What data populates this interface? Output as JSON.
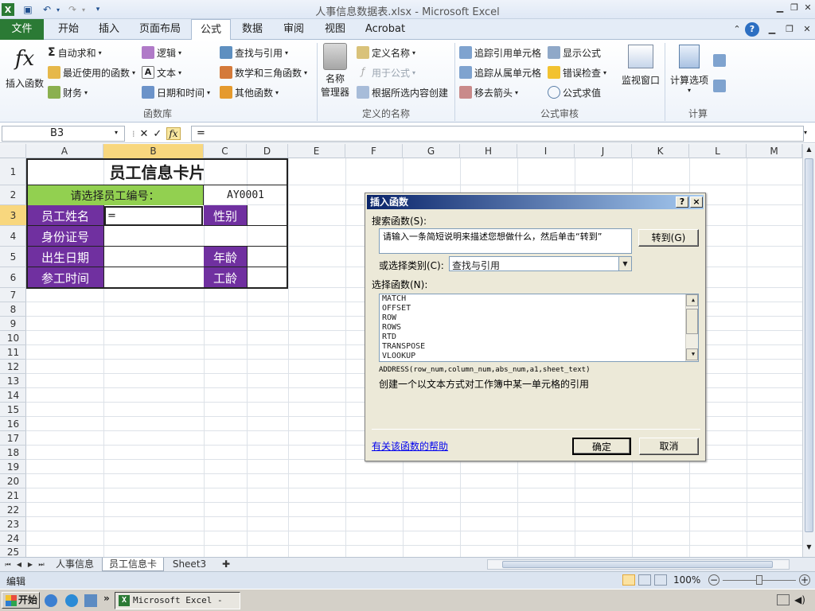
{
  "window": {
    "title": "人事信息数据表.xlsx - Microsoft Excel"
  },
  "tabs": {
    "file": "文件",
    "items": [
      "开始",
      "插入",
      "页面布局",
      "公式",
      "数据",
      "审阅",
      "视图",
      "Acrobat"
    ],
    "active": "公式"
  },
  "ribbon": {
    "insert_function": "插入函数",
    "autosum": "自动求和",
    "recent": "最近使用的函数",
    "finance": "财务",
    "logic": "逻辑",
    "text": "文本",
    "datetime": "日期和时间",
    "lookup": "查找与引用",
    "math": "数学和三角函数",
    "other": "其他函数",
    "group_library": "函数库",
    "name_manager_1": "名称",
    "name_manager_2": "管理器",
    "define_name": "定义名称",
    "use_in_formula": "用于公式",
    "create_from_sel": "根据所选内容创建",
    "group_names": "定义的名称",
    "trace_prec": "追踪引用单元格",
    "trace_dep": "追踪从属单元格",
    "remove_arrows": "移去箭头",
    "show_formulas": "显示公式",
    "error_check": "错误检查",
    "eval_formula": "公式求值",
    "group_audit": "公式审核",
    "watch": "监视窗口",
    "calc_options": "计算选项",
    "group_calc": "计算"
  },
  "formula_bar": {
    "name_box": "B3",
    "formula": "="
  },
  "columns": [
    "A",
    "B",
    "C",
    "D",
    "E",
    "F",
    "G",
    "H",
    "I",
    "J",
    "K",
    "L",
    "M"
  ],
  "rows": [
    "1",
    "2",
    "3",
    "4",
    "5",
    "6",
    "7",
    "8",
    "9",
    "10",
    "11",
    "12",
    "13",
    "14",
    "15",
    "16",
    "17",
    "18",
    "19",
    "20",
    "21",
    "22",
    "23",
    "24",
    "25"
  ],
  "card": {
    "title": "员工信息卡片",
    "select_label": "请选择员工编号：",
    "select_value": "AY0001",
    "name": "员工姓名",
    "b3_value": "=",
    "gender": "性别",
    "id": "身份证号",
    "birth": "出生日期",
    "age": "年龄",
    "join": "参工时间",
    "seniority": "工龄"
  },
  "dialog": {
    "title": "插入函数",
    "help_btn": "?",
    "close_btn": "×",
    "search_label": "搜索函数(S):",
    "search_text": "请输入一条简短说明来描述您想做什么，然后单击“转到”",
    "go_btn": "转到(G)",
    "category_label": "或选择类别(C):",
    "category_value": "查找与引用",
    "select_label": "选择函数(N):",
    "functions": [
      "MATCH",
      "OFFSET",
      "ROW",
      "ROWS",
      "RTD",
      "TRANSPOSE",
      "VLOOKUP"
    ],
    "syntax": "ADDRESS(row_num,column_num,abs_num,a1,sheet_text)",
    "description": "创建一个以文本方式对工作簿中某一单元格的引用",
    "help_link": "有关该函数的帮助",
    "ok": "确定",
    "cancel": "取消"
  },
  "sheets": [
    "人事信息",
    "员工信息卡",
    "Sheet3"
  ],
  "status": {
    "mode": "编辑",
    "zoom": "100%"
  },
  "taskbar": {
    "start": "开始",
    "app": "Microsoft Excel - ..."
  }
}
